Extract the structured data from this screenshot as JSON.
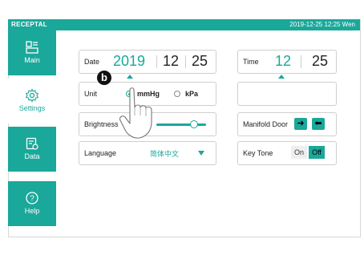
{
  "topbar": {
    "brand": "RECEPTAL",
    "datetime": "2019-12-25  12:25  Wen"
  },
  "sidebar": {
    "items": [
      {
        "label": "Main",
        "icon": "main-icon"
      },
      {
        "label": "Settings",
        "icon": "gear-icon",
        "active": true
      },
      {
        "label": "Data",
        "icon": "data-icon"
      },
      {
        "label": "Help",
        "icon": "help-icon"
      }
    ]
  },
  "settings": {
    "date": {
      "label": "Date",
      "year": "2019",
      "month": "12",
      "day": "25"
    },
    "time": {
      "label": "Time",
      "hour": "12",
      "minute": "25"
    },
    "unit": {
      "label": "Unit",
      "options": [
        "mmHg",
        "kPa"
      ],
      "selected": "mmHg"
    },
    "brightness": {
      "label": "Brightness",
      "level_percent": 75
    },
    "manifold_door": {
      "label": "Manifold Door"
    },
    "language": {
      "label": "Language",
      "value": "简体中文"
    },
    "key_tone": {
      "label": "Key Tone",
      "on_label": "On",
      "off_label": "Off",
      "selected": "Off"
    }
  },
  "callout": {
    "letter": "b"
  },
  "colors": {
    "accent": "#1aa89a"
  }
}
